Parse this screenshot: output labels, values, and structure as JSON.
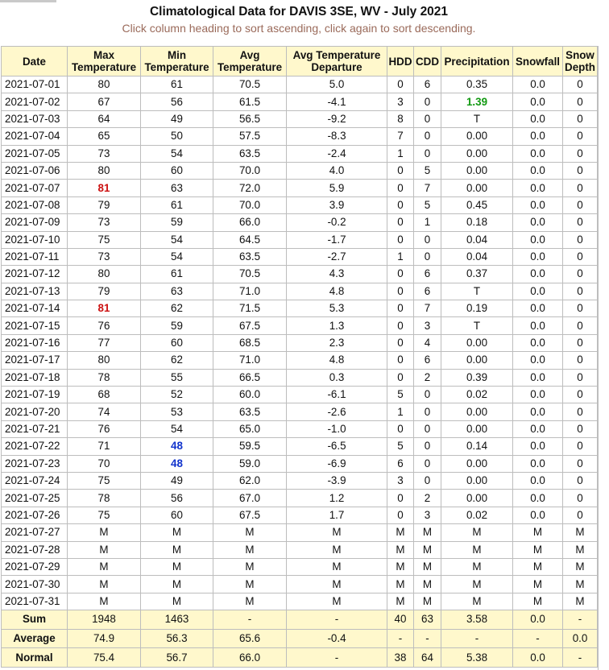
{
  "page": {
    "title": "Climatological Data for DAVIS 3SE, WV - July 2021",
    "subtitle": "Click column heading to sort ascending, click again to sort descending."
  },
  "columns": [
    {
      "key": "date",
      "label": "Date"
    },
    {
      "key": "max",
      "label": "Max Temperature"
    },
    {
      "key": "min",
      "label": "Min Temperature"
    },
    {
      "key": "avg",
      "label": "Avg Temperature"
    },
    {
      "key": "dep",
      "label": "Avg Temperature Departure"
    },
    {
      "key": "hdd",
      "label": "HDD"
    },
    {
      "key": "cdd",
      "label": "CDD"
    },
    {
      "key": "pcp",
      "label": "Precipitation"
    },
    {
      "key": "snow",
      "label": "Snowfall"
    },
    {
      "key": "depth",
      "label": "Snow Depth"
    }
  ],
  "rows": [
    [
      "2021-07-01",
      "80",
      "61",
      "70.5",
      "5.0",
      "0",
      "6",
      "0.35",
      "0.0",
      "0"
    ],
    [
      "2021-07-02",
      "67",
      "56",
      "61.5",
      "-4.1",
      "3",
      "0",
      "1.39",
      "0.0",
      "0"
    ],
    [
      "2021-07-03",
      "64",
      "49",
      "56.5",
      "-9.2",
      "8",
      "0",
      "T",
      "0.0",
      "0"
    ],
    [
      "2021-07-04",
      "65",
      "50",
      "57.5",
      "-8.3",
      "7",
      "0",
      "0.00",
      "0.0",
      "0"
    ],
    [
      "2021-07-05",
      "73",
      "54",
      "63.5",
      "-2.4",
      "1",
      "0",
      "0.00",
      "0.0",
      "0"
    ],
    [
      "2021-07-06",
      "80",
      "60",
      "70.0",
      "4.0",
      "0",
      "5",
      "0.00",
      "0.0",
      "0"
    ],
    [
      "2021-07-07",
      "81",
      "63",
      "72.0",
      "5.9",
      "0",
      "7",
      "0.00",
      "0.0",
      "0"
    ],
    [
      "2021-07-08",
      "79",
      "61",
      "70.0",
      "3.9",
      "0",
      "5",
      "0.45",
      "0.0",
      "0"
    ],
    [
      "2021-07-09",
      "73",
      "59",
      "66.0",
      "-0.2",
      "0",
      "1",
      "0.18",
      "0.0",
      "0"
    ],
    [
      "2021-07-10",
      "75",
      "54",
      "64.5",
      "-1.7",
      "0",
      "0",
      "0.04",
      "0.0",
      "0"
    ],
    [
      "2021-07-11",
      "73",
      "54",
      "63.5",
      "-2.7",
      "1",
      "0",
      "0.04",
      "0.0",
      "0"
    ],
    [
      "2021-07-12",
      "80",
      "61",
      "70.5",
      "4.3",
      "0",
      "6",
      "0.37",
      "0.0",
      "0"
    ],
    [
      "2021-07-13",
      "79",
      "63",
      "71.0",
      "4.8",
      "0",
      "6",
      "T",
      "0.0",
      "0"
    ],
    [
      "2021-07-14",
      "81",
      "62",
      "71.5",
      "5.3",
      "0",
      "7",
      "0.19",
      "0.0",
      "0"
    ],
    [
      "2021-07-15",
      "76",
      "59",
      "67.5",
      "1.3",
      "0",
      "3",
      "T",
      "0.0",
      "0"
    ],
    [
      "2021-07-16",
      "77",
      "60",
      "68.5",
      "2.3",
      "0",
      "4",
      "0.00",
      "0.0",
      "0"
    ],
    [
      "2021-07-17",
      "80",
      "62",
      "71.0",
      "4.8",
      "0",
      "6",
      "0.00",
      "0.0",
      "0"
    ],
    [
      "2021-07-18",
      "78",
      "55",
      "66.5",
      "0.3",
      "0",
      "2",
      "0.39",
      "0.0",
      "0"
    ],
    [
      "2021-07-19",
      "68",
      "52",
      "60.0",
      "-6.1",
      "5",
      "0",
      "0.02",
      "0.0",
      "0"
    ],
    [
      "2021-07-20",
      "74",
      "53",
      "63.5",
      "-2.6",
      "1",
      "0",
      "0.00",
      "0.0",
      "0"
    ],
    [
      "2021-07-21",
      "76",
      "54",
      "65.0",
      "-1.0",
      "0",
      "0",
      "0.00",
      "0.0",
      "0"
    ],
    [
      "2021-07-22",
      "71",
      "48",
      "59.5",
      "-6.5",
      "5",
      "0",
      "0.14",
      "0.0",
      "0"
    ],
    [
      "2021-07-23",
      "70",
      "48",
      "59.0",
      "-6.9",
      "6",
      "0",
      "0.00",
      "0.0",
      "0"
    ],
    [
      "2021-07-24",
      "75",
      "49",
      "62.0",
      "-3.9",
      "3",
      "0",
      "0.00",
      "0.0",
      "0"
    ],
    [
      "2021-07-25",
      "78",
      "56",
      "67.0",
      "1.2",
      "0",
      "2",
      "0.00",
      "0.0",
      "0"
    ],
    [
      "2021-07-26",
      "75",
      "60",
      "67.5",
      "1.7",
      "0",
      "3",
      "0.02",
      "0.0",
      "0"
    ],
    [
      "2021-07-27",
      "M",
      "M",
      "M",
      "M",
      "M",
      "M",
      "M",
      "M",
      "M"
    ],
    [
      "2021-07-28",
      "M",
      "M",
      "M",
      "M",
      "M",
      "M",
      "M",
      "M",
      "M"
    ],
    [
      "2021-07-29",
      "M",
      "M",
      "M",
      "M",
      "M",
      "M",
      "M",
      "M",
      "M"
    ],
    [
      "2021-07-30",
      "M",
      "M",
      "M",
      "M",
      "M",
      "M",
      "M",
      "M",
      "M"
    ],
    [
      "2021-07-31",
      "M",
      "M",
      "M",
      "M",
      "M",
      "M",
      "M",
      "M",
      "M"
    ]
  ],
  "highlights": [
    {
      "row": 6,
      "col": 1,
      "style": "hi"
    },
    {
      "row": 13,
      "col": 1,
      "style": "hi"
    },
    {
      "row": 21,
      "col": 2,
      "style": "lo"
    },
    {
      "row": 22,
      "col": 2,
      "style": "lo"
    },
    {
      "row": 1,
      "col": 7,
      "style": "pr"
    }
  ],
  "highlight_colors": {
    "hi": "#cc1111",
    "lo": "#1133cc",
    "pr": "#119911"
  },
  "summary": [
    [
      "Sum",
      "1948",
      "1463",
      "-",
      "-",
      "40",
      "63",
      "3.58",
      "0.0",
      "-"
    ],
    [
      "Average",
      "74.9",
      "56.3",
      "65.6",
      "-0.4",
      "-",
      "-",
      "-",
      "-",
      "0.0"
    ],
    [
      "Normal",
      "75.4",
      "56.7",
      "66.0",
      "-",
      "38",
      "64",
      "5.38",
      "0.0",
      "-"
    ]
  ],
  "colors": {
    "header_bg": "#fff8cc",
    "border": "#bdbdbd",
    "subtitle": "#9a6a5a"
  }
}
